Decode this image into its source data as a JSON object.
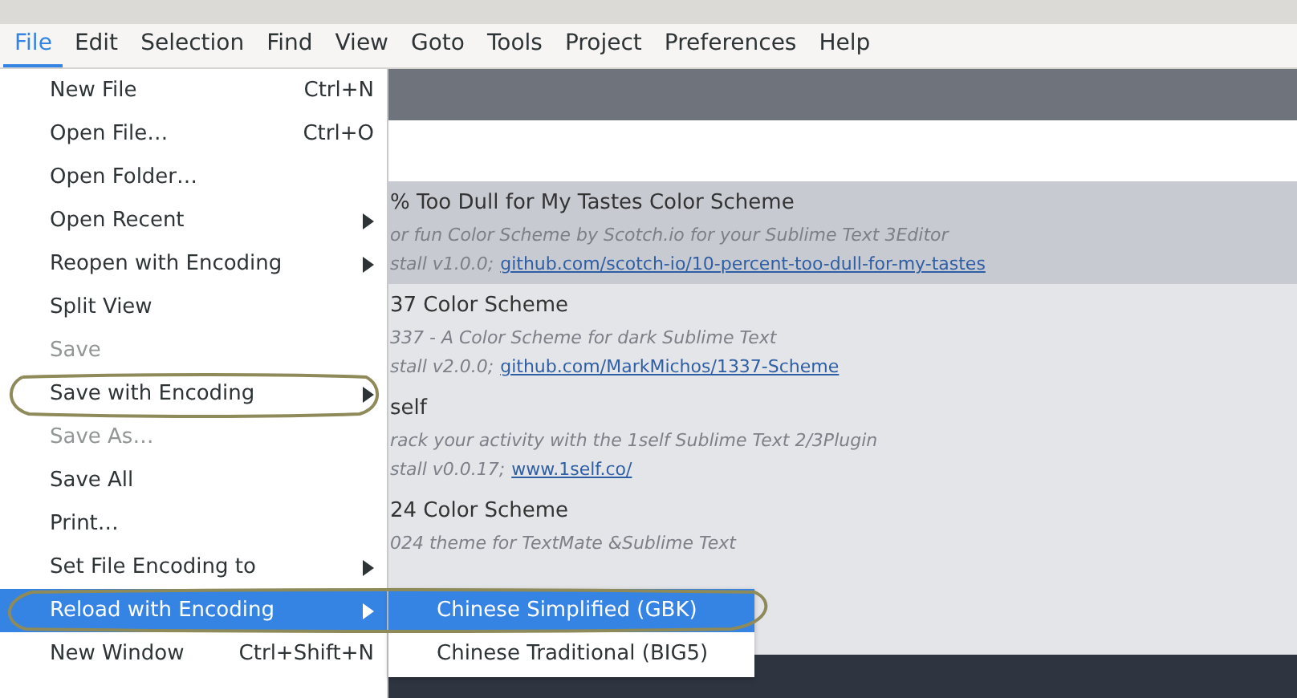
{
  "menubar": [
    {
      "label": "File",
      "selected": true
    },
    {
      "label": "Edit",
      "selected": false
    },
    {
      "label": "Selection",
      "selected": false
    },
    {
      "label": "Find",
      "selected": false
    },
    {
      "label": "View",
      "selected": false
    },
    {
      "label": "Goto",
      "selected": false
    },
    {
      "label": "Tools",
      "selected": false
    },
    {
      "label": "Project",
      "selected": false
    },
    {
      "label": "Preferences",
      "selected": false
    },
    {
      "label": "Help",
      "selected": false
    }
  ],
  "file_menu": [
    {
      "label": "New File",
      "shortcut": "Ctrl+N",
      "submenu": false,
      "disabled": false,
      "selected": false
    },
    {
      "label": "Open File…",
      "shortcut": "Ctrl+O",
      "submenu": false,
      "disabled": false,
      "selected": false
    },
    {
      "label": "Open Folder…",
      "submenu": false,
      "disabled": false,
      "selected": false
    },
    {
      "label": "Open Recent",
      "submenu": true,
      "disabled": false,
      "selected": false
    },
    {
      "label": "Reopen with Encoding",
      "submenu": true,
      "disabled": false,
      "selected": false
    },
    {
      "label": "Split View",
      "submenu": false,
      "disabled": false,
      "selected": false
    },
    {
      "label": "Save",
      "submenu": false,
      "disabled": true,
      "selected": false
    },
    {
      "label": "Save with Encoding",
      "submenu": true,
      "disabled": false,
      "selected": false
    },
    {
      "label": "Save As…",
      "submenu": false,
      "disabled": true,
      "selected": false
    },
    {
      "label": "Save All",
      "submenu": false,
      "disabled": false,
      "selected": false
    },
    {
      "label": "Print…",
      "submenu": false,
      "disabled": false,
      "selected": false
    },
    {
      "label": "Set File Encoding to",
      "submenu": true,
      "disabled": false,
      "selected": false
    },
    {
      "label": "Reload with Encoding",
      "submenu": true,
      "disabled": false,
      "selected": true
    },
    {
      "label": "New Window",
      "shortcut": "Ctrl+Shift+N",
      "submenu": false,
      "disabled": false,
      "selected": false
    }
  ],
  "encoding_submenu": [
    {
      "label": "Chinese Simplified (GBK)",
      "selected": true
    },
    {
      "label": "Chinese Traditional (BIG5)",
      "selected": false
    }
  ],
  "packages": [
    {
      "name": "% Too Dull for My Tastes Color Scheme",
      "description": "or fun Color Scheme by Scotch.io for your Sublime Text 3Editor",
      "install": "stall v1.0.0;",
      "link": "github.com/scotch-io/10-percent-too-dull-for-my-tastes",
      "selected": true
    },
    {
      "name": "37 Color Scheme",
      "description": "337 - A Color Scheme for dark Sublime Text",
      "install": "stall v2.0.0;",
      "link": "github.com/MarkMichos/1337-Scheme",
      "selected": false
    },
    {
      "name": "self",
      "description": "rack your activity with the 1self Sublime Text 2/3Plugin",
      "install": "stall v0.0.17;",
      "link": "www.1self.co/",
      "selected": false
    },
    {
      "name": "24 Color Scheme",
      "description": "024 theme for TextMate &Sublime Text",
      "selected": false
    }
  ]
}
